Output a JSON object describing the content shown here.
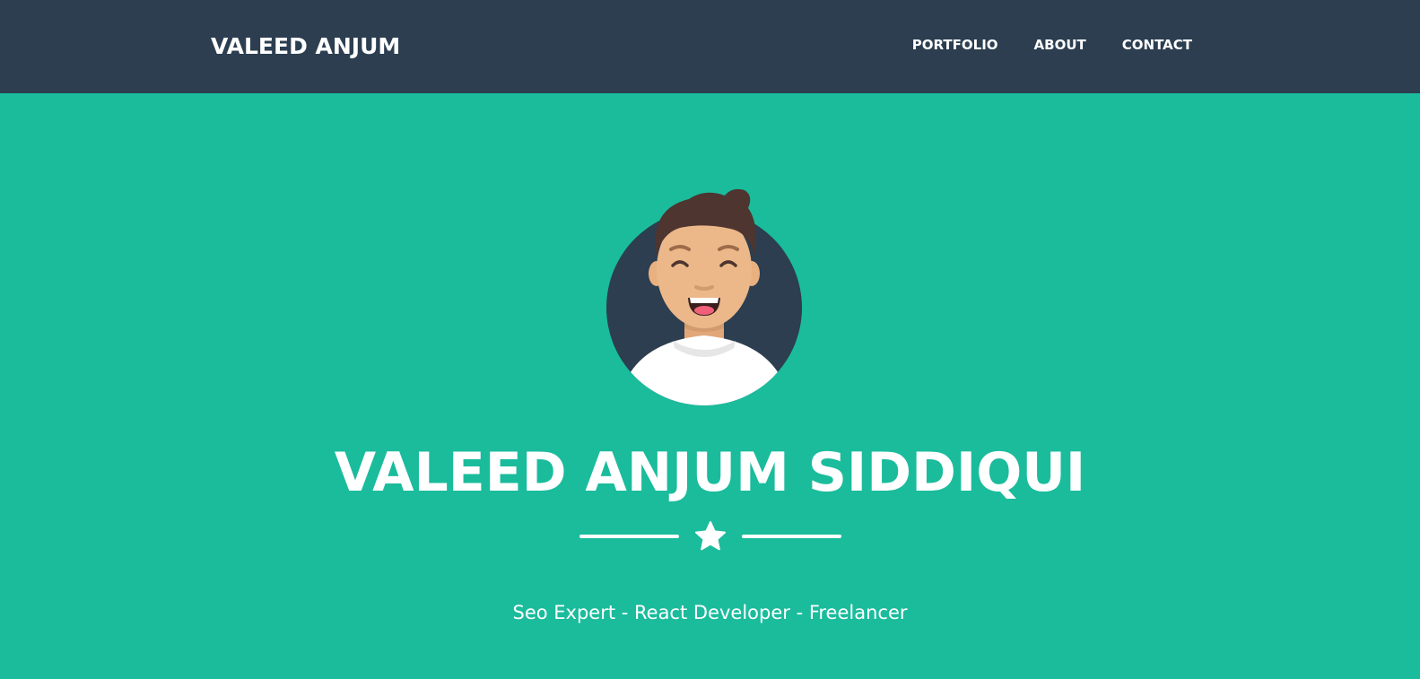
{
  "navbar": {
    "brand": "VALEED ANJUM",
    "links": [
      {
        "label": "PORTFOLIO"
      },
      {
        "label": "ABOUT"
      },
      {
        "label": "CONTACT"
      }
    ]
  },
  "hero": {
    "avatar": "avatar-icon",
    "title": "VALEED ANJUM SIDDIQUI",
    "divider_icon": "star-icon",
    "subtitle": "Seo Expert - React Developer - Freelancer"
  },
  "colors": {
    "navbar_bg": "#2c3e50",
    "hero_bg": "#1abc9c",
    "text": "#ffffff"
  }
}
